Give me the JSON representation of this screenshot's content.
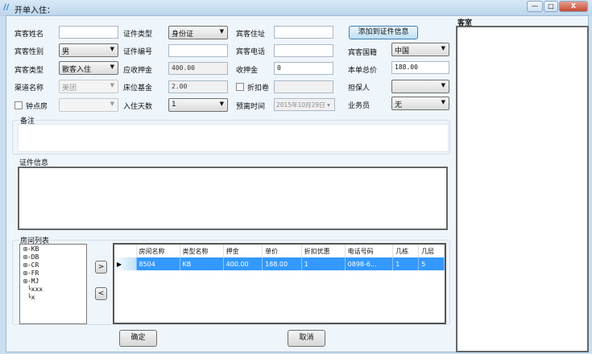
{
  "window": {
    "title": "开单入住：",
    "minimize": "—",
    "maximize": "□",
    "close": "X"
  },
  "form": {
    "guest_name_label": "宾客姓名",
    "guest_name": "",
    "gender_label": "宾客性别",
    "gender": "男",
    "guest_type_label": "宾客类型",
    "guest_type": "散客入住",
    "channel_label": "渠道名称",
    "channel": "美团",
    "hourly_room_label": "钟点房",
    "hourly_room_value": "",
    "id_type_label": "证件类型",
    "id_type": "身份证",
    "id_number_label": "证件编号",
    "id_number": "",
    "deposit_due_label": "应收押金",
    "deposit_due": "400.00",
    "bed_fee_label": "床位基金",
    "bed_fee": "2.00",
    "days_label": "入住天数",
    "days": "1",
    "address_label": "宾客住址",
    "address": "",
    "phone_label": "宾客电话",
    "phone": "",
    "deposit_label": "收押金",
    "deposit": "0",
    "coupon_label": "折扣卷",
    "coupon": "",
    "departure_label": "预离时间",
    "departure": "2015年10月29日",
    "add_id_button": "添加到证件信息",
    "nationality_label": "宾客国籍",
    "nationality": "中国",
    "total_label": "本单总价",
    "total": "188.00",
    "guarantor_label": "担保人",
    "guarantor": "",
    "salesperson_label": "业务员",
    "salesperson": "无",
    "remarks_label": "备注",
    "id_info_label": "证件信息"
  },
  "guest_room_label": "客室",
  "room_list": {
    "label": "房间列表",
    "tree": [
      "KB",
      "DB",
      "CR",
      "FR",
      "MJ"
    ],
    "leaves": [
      "xxx",
      "x"
    ],
    "add": ">",
    "remove": "<"
  },
  "grid": {
    "columns": [
      "房间名称",
      "类型名称",
      "押金",
      "单价",
      "折扣优惠",
      "电话号码",
      "几栋",
      "几层"
    ],
    "rows": [
      [
        "8504",
        "KB",
        "400.00",
        "188.00",
        "1",
        "0898-6...",
        "1",
        "5"
      ]
    ]
  },
  "buttons": {
    "ok": "确定",
    "cancel": "取消"
  }
}
